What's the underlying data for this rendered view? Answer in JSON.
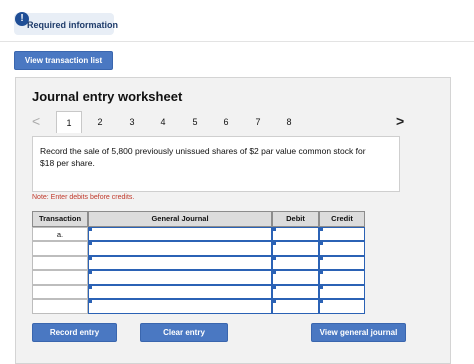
{
  "top_text": "· · · · · · · · · · · · · · ·",
  "required": {
    "icon": "!",
    "label": "Required information"
  },
  "buttons": {
    "view_transaction_list": "View transaction list",
    "record_entry": "Record entry",
    "clear_entry": "Clear entry",
    "view_general_journal": "View general journal"
  },
  "worksheet": {
    "title": "Journal entry worksheet",
    "prev_arrow": "<",
    "next_arrow": ">",
    "tabs": [
      "1",
      "2",
      "3",
      "4",
      "5",
      "6",
      "7",
      "8"
    ],
    "active_tab": "1",
    "prompt": "Record the sale of 5,800 previously unissued shares of $2 par value common stock for $18 per share.",
    "note": "Note: Enter debits before credits."
  },
  "journal_table": {
    "headers": [
      "Transaction",
      "General Journal",
      "Debit",
      "Credit"
    ],
    "rows": [
      {
        "transaction": "a.",
        "account": "",
        "debit": "",
        "credit": ""
      },
      {
        "transaction": "",
        "account": "",
        "debit": "",
        "credit": ""
      },
      {
        "transaction": "",
        "account": "",
        "debit": "",
        "credit": ""
      },
      {
        "transaction": "",
        "account": "",
        "debit": "",
        "credit": ""
      },
      {
        "transaction": "",
        "account": "",
        "debit": "",
        "credit": ""
      },
      {
        "transaction": "",
        "account": "",
        "debit": "",
        "credit": ""
      }
    ]
  },
  "colors": {
    "accent": "#4a78c2",
    "note": "#c0392b",
    "input_border": "#2b62b5"
  }
}
